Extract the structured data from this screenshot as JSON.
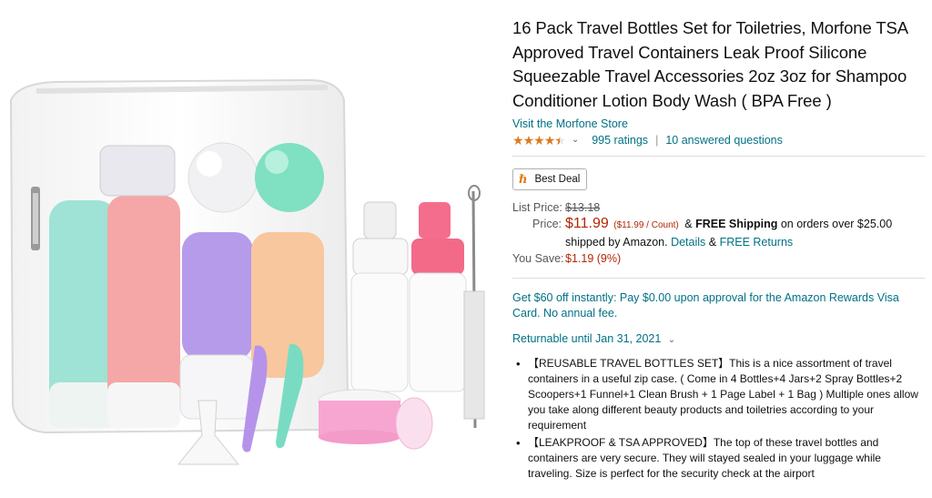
{
  "product": {
    "title": "16 Pack Travel Bottles Set for Toiletries, Morfone TSA Approved Travel Containers Leak Proof Silicone Squeezable Travel Accessories 2oz 3oz for Shampoo Conditioner Lotion Body Wash ( BPA Free )",
    "store_link": "Visit the Morfone Store",
    "rating": 4.5,
    "ratings_count": "995 ratings",
    "answered_questions": "10 answered questions",
    "deal_badge": "Best Deal"
  },
  "pricing": {
    "list_price_label": "List Price:",
    "list_price": "$13.18",
    "price_label": "Price:",
    "price": "$11.99",
    "price_per_count": "($11.99 / Count)",
    "shipping_prefix": "&",
    "free_shipping": "FREE Shipping",
    "shipping_suffix": "on orders over $25.00 shipped by Amazon.",
    "details_link": "Details",
    "amp": "&",
    "free_returns_link": "FREE Returns",
    "you_save_label": "You Save:",
    "you_save": "$1.19 (9%)"
  },
  "promo": {
    "text": "Get $60 off instantly: Pay $0.00 upon approval for the Amazon Rewards Visa Card. No annual fee."
  },
  "returnable": {
    "text": "Returnable until Jan 31, 2021"
  },
  "bullets": [
    "【REUSABLE TRAVEL BOTTLES SET】This is a nice assortment of travel containers in a useful zip case. ( Come in 4 Bottles+4 Jars+2 Spray Bottles+2 Scoopers+1 Funnel+1 Clean Brush + 1 Page Label + 1 Bag ) Multiple ones allow you take along different beauty products and toiletries according to your requirement",
    "【LEAKPROOF & TSA APPROVED】The top of these travel bottles and containers are very secure. They will stayed sealed in your luggage while traveling. Size is perfect for the security check at the airport"
  ],
  "colors": {
    "link": "#007185",
    "price": "#B12704",
    "star": "#DE7921",
    "text": "#0F1111"
  },
  "icons": {
    "star": "star-icon",
    "deal": "deal-icon",
    "chevron": "chevron-down-icon"
  }
}
